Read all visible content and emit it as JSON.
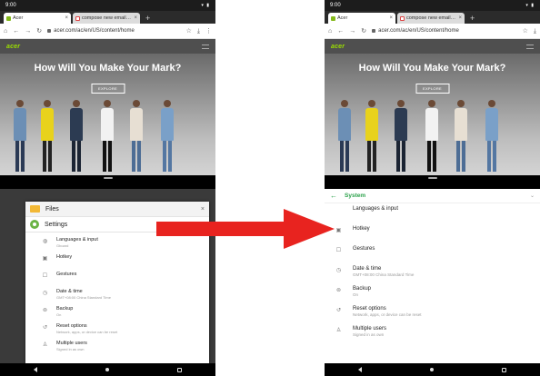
{
  "status_bar": {
    "time": "9:00",
    "icons": "▾ ▮"
  },
  "browser": {
    "tabs": [
      {
        "title": "Acer",
        "close": "×",
        "favicon": "acer"
      },
      {
        "title": "compose new email - G",
        "close": "×",
        "favicon": "gmail"
      }
    ],
    "new_tab": "+",
    "url": "acer.com/ac/en/US/content/home"
  },
  "site": {
    "logo": "acer",
    "hero_title": "How Will You Make Your Mark?",
    "explore_label": "EXPLORE"
  },
  "left_panel": {
    "files_label": "Files",
    "settings_label": "Settings",
    "close": "×",
    "items": [
      {
        "title": "Languages & input",
        "sub": "Gboard",
        "icon": "◍"
      },
      {
        "title": "Hotkey",
        "sub": "",
        "icon": "▣"
      },
      {
        "title": "Gestures",
        "sub": "",
        "icon": "☐"
      },
      {
        "title": "Date & time",
        "sub": "GMT+08:00 China Standard Time",
        "icon": "◷"
      },
      {
        "title": "Backup",
        "sub": "On",
        "icon": "⊚"
      },
      {
        "title": "Reset options",
        "sub": "Network, apps, or device can be reset",
        "icon": "↺"
      },
      {
        "title": "Multiple users",
        "sub": "Signed in as own",
        "icon": "♙"
      }
    ]
  },
  "right_panel": {
    "header": "System",
    "back": "←",
    "items": [
      {
        "title": "Languages & input",
        "sub": "",
        "icon": ""
      },
      {
        "title": "Hotkey",
        "sub": "",
        "icon": "▣"
      },
      {
        "title": "Gestures",
        "sub": "",
        "icon": "☐"
      },
      {
        "title": "Date & time",
        "sub": "GMT+08:00 China Standard Time",
        "icon": "◷"
      },
      {
        "title": "Backup",
        "sub": "On",
        "icon": "⊚"
      },
      {
        "title": "Reset options",
        "sub": "Network, apps, or device can be reset",
        "icon": "↺"
      },
      {
        "title": "Multiple users",
        "sub": "Signed in as own",
        "icon": "♙"
      }
    ]
  },
  "colors": {
    "acer_green": "#9be000",
    "settings_green": "#2aa14a",
    "arrow_red": "#e8231f"
  }
}
